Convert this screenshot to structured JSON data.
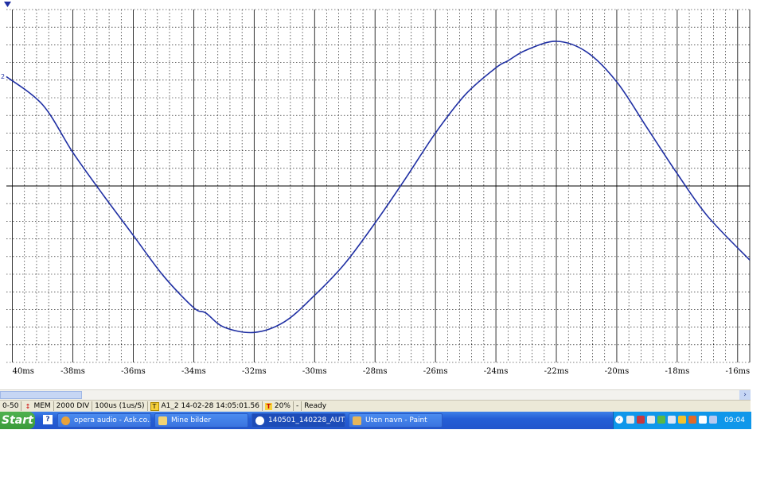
{
  "chart_data": {
    "type": "line",
    "xlabel": "",
    "ylabel": "",
    "x_unit": "ms",
    "x_ticks": [
      "40ms",
      "-38ms",
      "-36ms",
      "-34ms",
      "-32ms",
      "-30ms",
      "-28ms",
      "-26ms",
      "-24ms",
      "-22ms",
      "-20ms",
      "-18ms",
      "-16ms"
    ],
    "xlim": [
      -40.2,
      -15.6
    ],
    "ylim": [
      -1.0,
      1.0
    ],
    "grid": true,
    "channel_marker": "2",
    "series": [
      {
        "color": "#1f2fa3",
        "x": [
          -40.2,
          -39.0,
          -38.0,
          -37.0,
          -36.0,
          -35.0,
          -34.0,
          -33.6,
          -33.0,
          -32.0,
          -31.0,
          -30.0,
          -29.0,
          -28.0,
          -27.0,
          -26.0,
          -25.0,
          -24.0,
          -23.6,
          -23.0,
          -22.0,
          -21.0,
          -20.0,
          -19.0,
          -18.0,
          -17.0,
          -15.6
        ],
        "y": [
          0.62,
          0.46,
          0.19,
          -0.05,
          -0.28,
          -0.51,
          -0.69,
          -0.72,
          -0.8,
          -0.83,
          -0.77,
          -0.62,
          -0.44,
          -0.21,
          0.04,
          0.3,
          0.52,
          0.67,
          0.71,
          0.77,
          0.82,
          0.76,
          0.59,
          0.33,
          0.07,
          -0.17,
          -0.42
        ]
      }
    ]
  },
  "scrollbar": {
    "right_arrow": "›"
  },
  "statusbar": {
    "cells": [
      "0-50",
      "MEM",
      "2000 DIV",
      "100us (1us/S)",
      "A1_2 14-02-28 14:05:01.56",
      "20%",
      "-",
      "Ready"
    ]
  },
  "taskbar": {
    "start": "Start",
    "quicklaunch_icon": "?",
    "buttons": [
      "opera audio - Ask.co...",
      "Mine bilder",
      "140501_140228_AUT...",
      "Uten navn - Paint"
    ],
    "clock": "09:04"
  },
  "colors": {
    "trace": "#1f2fa3",
    "grid": "#000000",
    "taskbar": "#245ed6",
    "tray": "#0f97ea"
  },
  "icons": [
    "trigger-marker-icon",
    "mem-icon",
    "trigger-icon",
    "position-icon",
    "help-icon",
    "opera-icon",
    "folder-icon",
    "app-icon",
    "paint-icon",
    "tray-icons",
    "chevron-left-icon"
  ]
}
